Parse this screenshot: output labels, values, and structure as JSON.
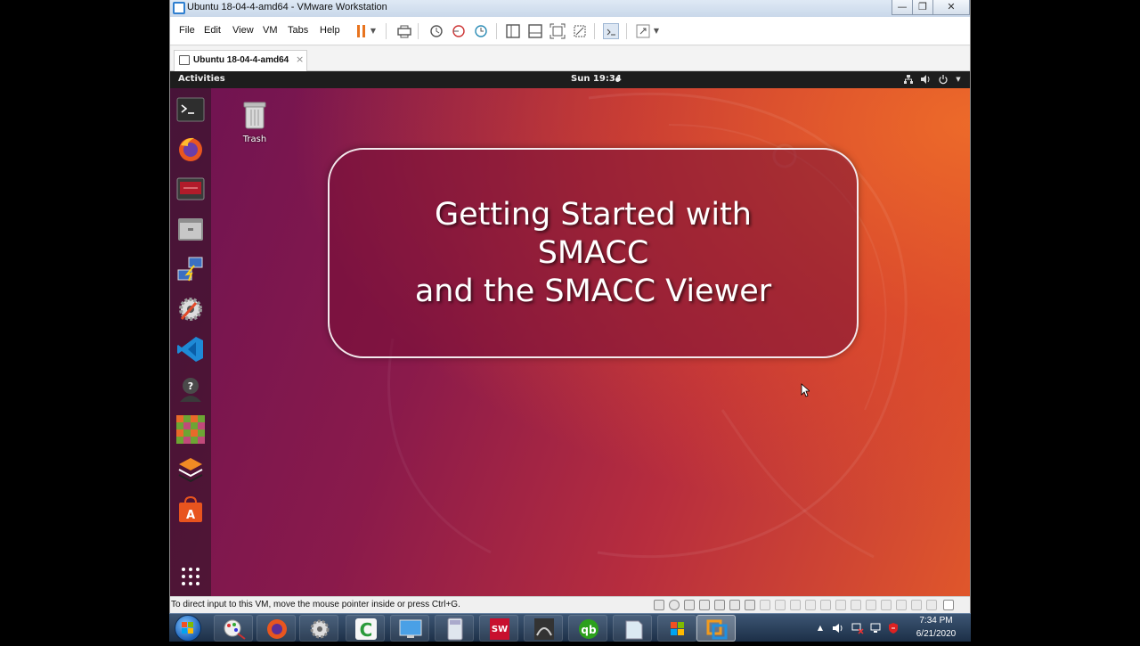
{
  "window": {
    "title": "Ubuntu 18-04-4-amd64 - VMware Workstation",
    "minimize": "—",
    "maximize": "❐",
    "close": "✕"
  },
  "menu": {
    "items": [
      "File",
      "Edit",
      "View",
      "VM",
      "Tabs",
      "Help"
    ]
  },
  "tab": {
    "label": "Ubuntu 18-04-4-amd64",
    "close": "×"
  },
  "ubuntu": {
    "activities": "Activities",
    "clock": "Sun 19:34",
    "trash_label": "Trash"
  },
  "slide": {
    "title": "Getting Started with SMACC and the SMACC Viewer"
  },
  "status": {
    "text": "To direct input to this VM, move the mouse pointer inside or press Ctrl+G."
  },
  "taskbar": {
    "time": "7:34 PM",
    "date": "6/21/2020"
  },
  "colors": {
    "ubuntu_orange": "#e0572b",
    "ubuntu_aubergine": "#6d1352",
    "vmware_pause": "#e8741f"
  }
}
